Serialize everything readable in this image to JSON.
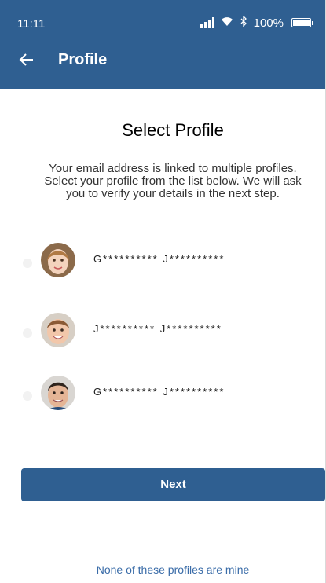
{
  "status_bar": {
    "time": "11:11",
    "battery": "100%",
    "icons": [
      "signal-icon",
      "wifi-icon",
      "bluetooth-icon",
      "battery-icon"
    ]
  },
  "header": {
    "back_icon": "arrow-left-icon",
    "title": "Profile",
    "background_color": "#2f5f91"
  },
  "main": {
    "heading": "Select Profile",
    "description": "Your email address is linked to multiple profiles. Select your profile from the list below. We will ask you to verify your details in the next step.",
    "profiles": [
      {
        "name": "G********** J**********",
        "avatar": "girl-avatar",
        "selected": false
      },
      {
        "name": "J********** J**********",
        "avatar": "boy-avatar",
        "selected": false
      },
      {
        "name": "G********** J**********",
        "avatar": "man-avatar",
        "selected": false
      }
    ],
    "next_label": "Next",
    "not_mine_label": "None of these profiles are mine"
  },
  "colors": {
    "primary": "#2f5f91",
    "link": "#3a6ca8"
  }
}
